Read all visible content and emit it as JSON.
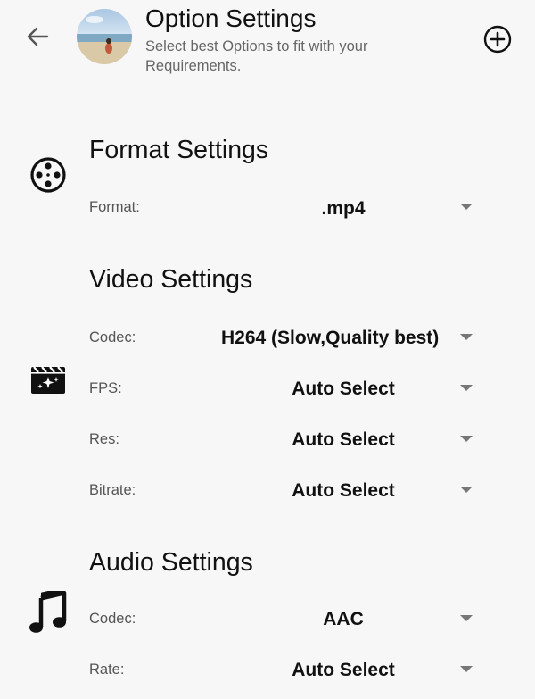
{
  "header": {
    "title": "Option Settings",
    "subtitle": "Select best Options to fit with your Requirements."
  },
  "sections": {
    "format": {
      "title": "Format Settings",
      "icon": "film-reel-icon",
      "rows": [
        {
          "label": "Format:",
          "value": ".mp4"
        }
      ]
    },
    "video": {
      "title": "Video Settings",
      "icon": "movie-clapper-icon",
      "rows": [
        {
          "label": "Codec:",
          "value": "H264 (Slow,Quality best)"
        },
        {
          "label": "FPS:",
          "value": "Auto Select"
        },
        {
          "label": "Res:",
          "value": "Auto Select"
        },
        {
          "label": "Bitrate:",
          "value": "Auto Select"
        }
      ]
    },
    "audio": {
      "title": "Audio Settings",
      "icon": "music-note-icon",
      "rows": [
        {
          "label": "Codec:",
          "value": "AAC"
        },
        {
          "label": "Rate:",
          "value": "Auto Select"
        }
      ]
    }
  },
  "colors": {
    "background": "#f7f7f7",
    "text": "#111111",
    "label": "#555555",
    "subtitle": "#666666",
    "arrow": "#777777"
  }
}
